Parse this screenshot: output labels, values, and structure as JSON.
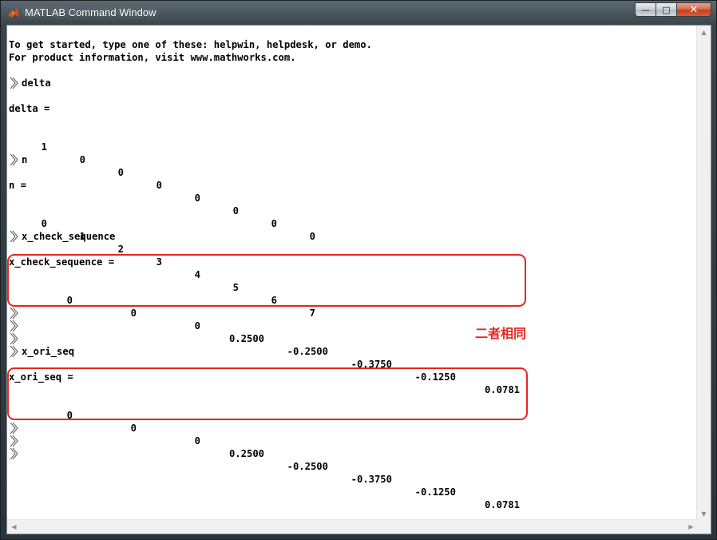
{
  "window": {
    "title": "MATLAB Command Window",
    "controls": {
      "minimize": "—",
      "maximize": "□",
      "close": "✕"
    }
  },
  "console": {
    "intro": [
      "To get started, type one of these: helpwin, helpdesk, or demo.",
      "For product information, visit www.mathworks.com."
    ],
    "cmd_delta": "delta",
    "out_delta_label": "delta =",
    "delta_values": [
      "1",
      "0",
      "0",
      "0",
      "0",
      "0",
      "0",
      "0"
    ],
    "cmd_n": "n",
    "out_n_label": "n =",
    "n_values": [
      "0",
      "1",
      "2",
      "3",
      "4",
      "5",
      "6",
      "7"
    ],
    "cmd_x_check": "x_check_sequence",
    "out_x_check_label": "x_check_sequence =",
    "x_check_values": [
      "0",
      "0",
      "0",
      "0.2500",
      "-0.2500",
      "-0.3750",
      "-0.1250",
      "0.0781"
    ],
    "cmd_x_ori": "x_ori_seq",
    "out_x_ori_label": "x_ori_seq =",
    "x_ori_values": [
      "0",
      "0",
      "0",
      "0.2500",
      "-0.2500",
      "-0.3750",
      "-0.1250",
      "0.0781"
    ]
  },
  "annotation": {
    "text": "二者相同",
    "color": "#e8261d"
  },
  "scrollbars": {
    "up": "▲",
    "down": "▼",
    "left": "◀",
    "right": "▶"
  },
  "icons": {
    "prompt": "double-chevron-prompt-icon",
    "app": "matlab-logo-icon"
  }
}
